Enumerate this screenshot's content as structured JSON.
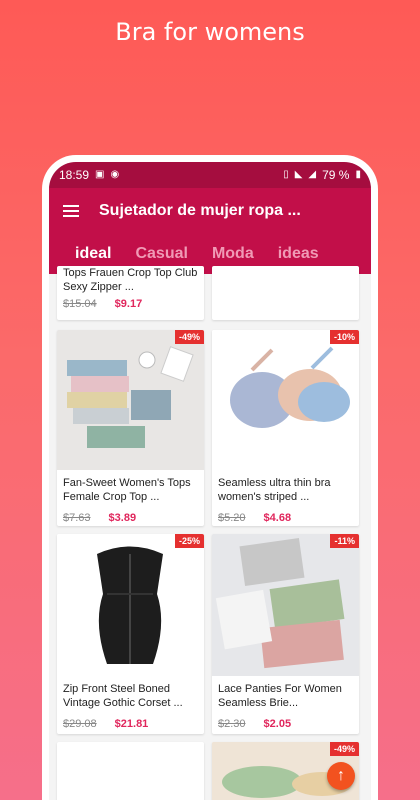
{
  "promo": {
    "title": "Bra for womens"
  },
  "status": {
    "time": "18:59",
    "battery": "79 %"
  },
  "toolbar": {
    "title": "Sujetador de mujer ropa ..."
  },
  "tabs": [
    {
      "label": "ideal"
    },
    {
      "label": "Casual"
    },
    {
      "label": "Moda"
    },
    {
      "label": "ideas"
    }
  ],
  "products": [
    {
      "title": "Tops Frauen Crop Top Club Sexy Zipper ...",
      "old_price": "$15.04",
      "new_price": "$9.17",
      "discount": ""
    },
    {
      "title": "",
      "old_price": "",
      "new_price": "",
      "discount": ""
    },
    {
      "title": "Fan-Sweet Women's Tops Female Crop Top ...",
      "old_price": "$7.63",
      "new_price": "$3.89",
      "discount": "-49%"
    },
    {
      "title": "Seamless ultra thin bra women's striped ...",
      "old_price": "$5.20",
      "new_price": "$4.68",
      "discount": "-10%"
    },
    {
      "title": "Zip Front Steel Boned Vintage Gothic Corset ...",
      "old_price": "$29.08",
      "new_price": "$21.81",
      "discount": "-25%"
    },
    {
      "title": "Lace Panties For Women Seamless Brie...",
      "old_price": "$2.30",
      "new_price": "$2.05",
      "discount": "-11%"
    },
    {
      "title": "",
      "old_price": "",
      "new_price": "",
      "discount": ""
    },
    {
      "title": "",
      "old_price": "",
      "new_price": "",
      "discount": "-49%"
    }
  ],
  "fab": {
    "icon": "arrow-up-icon"
  }
}
